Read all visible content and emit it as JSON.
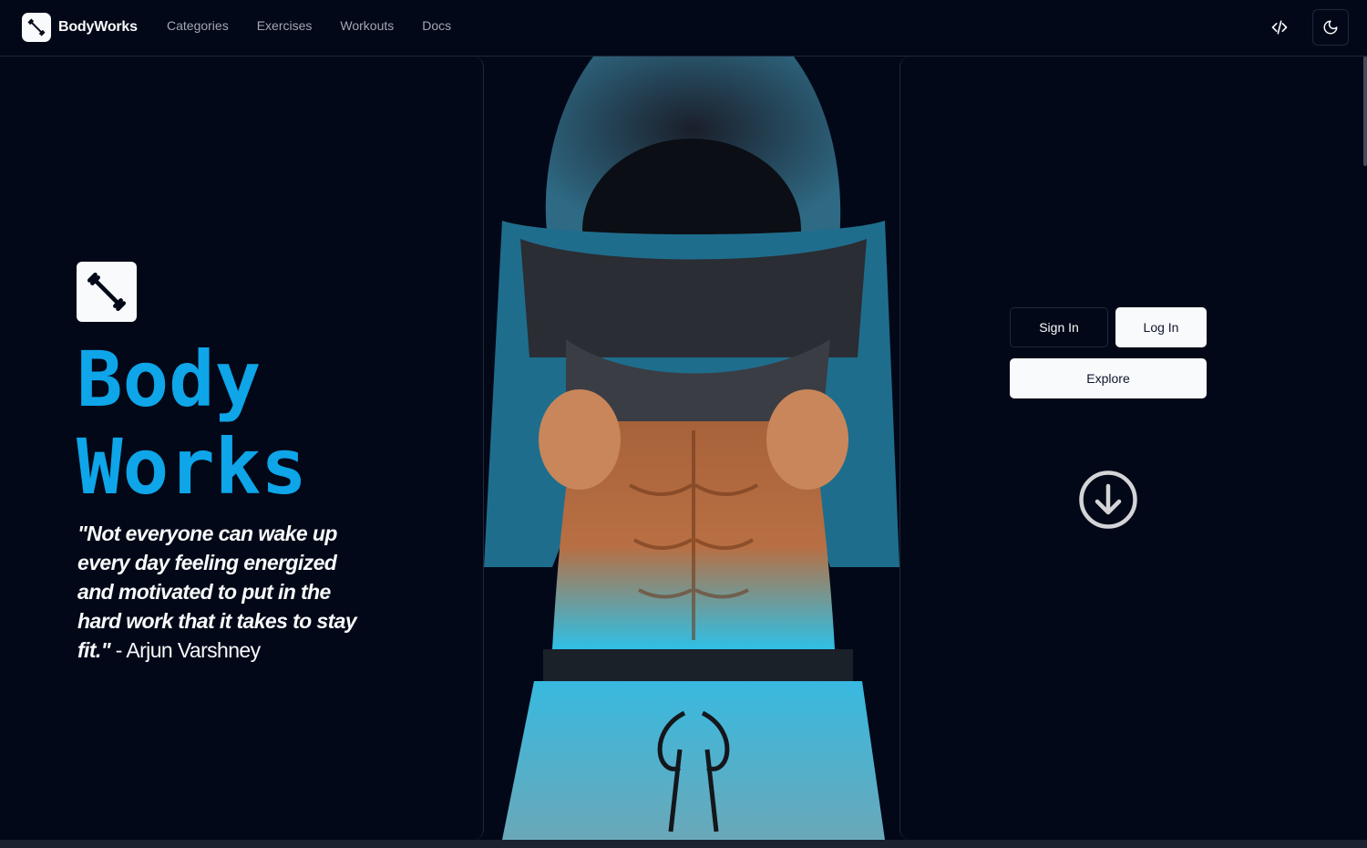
{
  "header": {
    "brand": "BodyWorks",
    "nav": [
      "Categories",
      "Exercises",
      "Workouts",
      "Docs"
    ],
    "icons": {
      "code": "code-icon",
      "theme": "moon-icon",
      "logo": "dumbbell-icon"
    }
  },
  "hero": {
    "title_line1": "Body",
    "title_line2": "Works",
    "quote": "\"Not everyone can wake up every day feeling energized and motivated to put in the hard work that it takes to stay fit.\"",
    "author": " - Arjun Varshney"
  },
  "actions": {
    "sign_in": "Sign In",
    "log_in": "Log In",
    "explore": "Explore"
  },
  "colors": {
    "background": "#020817",
    "accent": "#0ea5e9",
    "border": "#1e293b",
    "foreground": "#f8fafc"
  }
}
